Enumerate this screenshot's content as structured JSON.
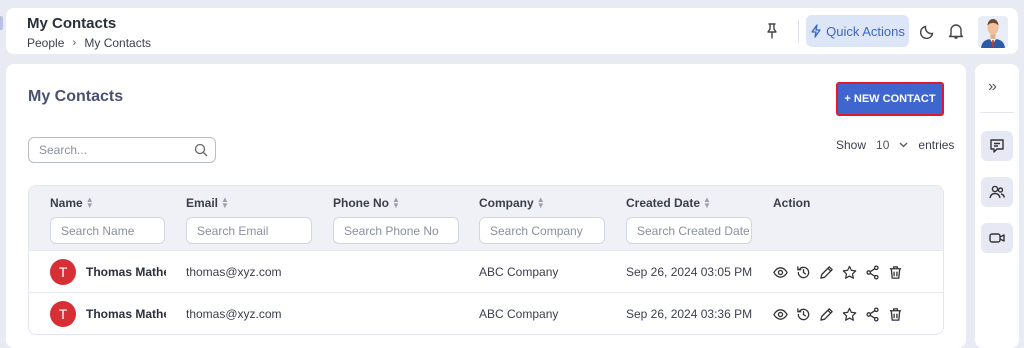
{
  "header": {
    "title": "My Contacts",
    "breadcrumb": [
      "People",
      "My Contacts"
    ],
    "quick_actions_label": "Quick Actions"
  },
  "page": {
    "heading": "My Contacts",
    "new_contact_label": "+ NEW CONTACT",
    "search_placeholder": "Search...",
    "show_label": "Show",
    "entries_value": "10",
    "entries_label": "entries"
  },
  "table": {
    "columns": [
      "Name",
      "Email",
      "Phone No",
      "Company",
      "Created Date",
      "Action"
    ],
    "filters": [
      "Search Name",
      "Search Email",
      "Search Phone No",
      "Search Company",
      "Search Created Date"
    ],
    "rows": [
      {
        "initial": "T",
        "name": "Thomas Mathev",
        "email": "thomas@xyz.com",
        "phone": "",
        "company": "ABC Company",
        "created": "Sep 26, 2024 03:05 PM"
      },
      {
        "initial": "T",
        "name": "Thomas Mathev",
        "email": "thomas@xyz.com",
        "phone": "",
        "company": "ABC Company",
        "created": "Sep 26, 2024 03:36 PM"
      }
    ]
  },
  "icons": {
    "row_actions": [
      "eye-icon",
      "history-icon",
      "pencil-icon",
      "star-icon",
      "share-icon",
      "trash-icon"
    ],
    "rail": [
      "chat-icon",
      "users-icon",
      "video-icon"
    ]
  },
  "colors": {
    "accent": "#3f66cf",
    "highlight_border": "#e2182c",
    "avatar_red": "#d62f36",
    "page_bg": "#e9ebf4"
  }
}
